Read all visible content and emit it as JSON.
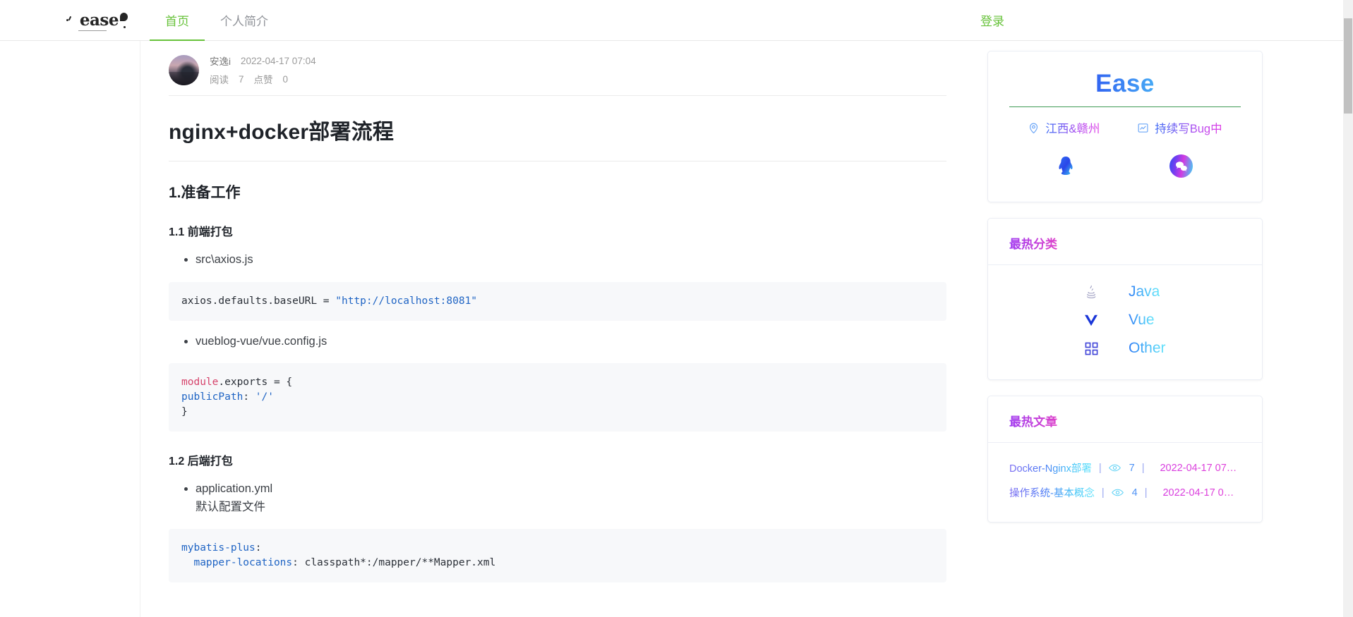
{
  "navbar": {
    "brand": "ease",
    "tabs": [
      {
        "label": "首页",
        "active": true
      },
      {
        "label": "个人简介",
        "active": false
      }
    ],
    "login_label": "登录"
  },
  "article": {
    "author": "安逸i",
    "published_at": "2022-04-17 07:04",
    "read_label": "阅读",
    "read_count": "7",
    "like_label": "点赞",
    "like_count": "0",
    "title": "nginx+docker部署流程",
    "sections": {
      "h2_1": "1.准备工作",
      "h3_1_1": "1.1 前端打包",
      "h3_1_2": "1.2 后端打包",
      "bullet_axios": "src\\axios.js",
      "bullet_vueconfig": "vueblog-vue/vue.config.js",
      "bullet_appyml": "application.yml",
      "bullet_appyml_sub": "默认配置文件"
    },
    "code_axios": {
      "plain_1": "axios.defaults.baseURL = ",
      "string_1": "\"http://localhost:8081\""
    },
    "code_vueconfig": {
      "red_1": "module",
      "plain_1": ".exports = {",
      "key_2": "publicPath",
      "plain_2": ": ",
      "string_2": "'/'",
      "plain_3": "}"
    },
    "code_yml": {
      "key_1": "mybatis-plus",
      "plain_1": ":",
      "key_2": "  mapper-locations",
      "plain_2": ": classpath*:/mapper/**Mapper.xml"
    }
  },
  "sidebar": {
    "profile": {
      "name": "Ease",
      "location_icon": "location-pin-icon",
      "location": "江西&赣州",
      "status_icon": "chart-icon",
      "status": "持续写Bug中",
      "social_qq": "qq-icon",
      "social_wechat": "wechat-icon"
    },
    "categories_card": {
      "title": "最热分类",
      "items": [
        {
          "icon": "java-icon",
          "label": "Java"
        },
        {
          "icon": "vue-icon",
          "label": "Vue"
        },
        {
          "icon": "grid-icon",
          "label": "Other"
        }
      ]
    },
    "hot_articles_card": {
      "title": "最热文章",
      "separator": "|",
      "views_icon": "eye-icon",
      "items": [
        {
          "title": "Docker-Nginx部署",
          "views": "7",
          "date": "2022-04-17 07…"
        },
        {
          "title": "操作系统-基本概念",
          "views": "4",
          "date": "2022-04-17 0…"
        }
      ]
    }
  },
  "colors": {
    "accent_green": "#67c23a",
    "code_string_blue": "#1f64c4",
    "code_keyword_red": "#d6436b",
    "code_bg": "#f7f8fa"
  }
}
